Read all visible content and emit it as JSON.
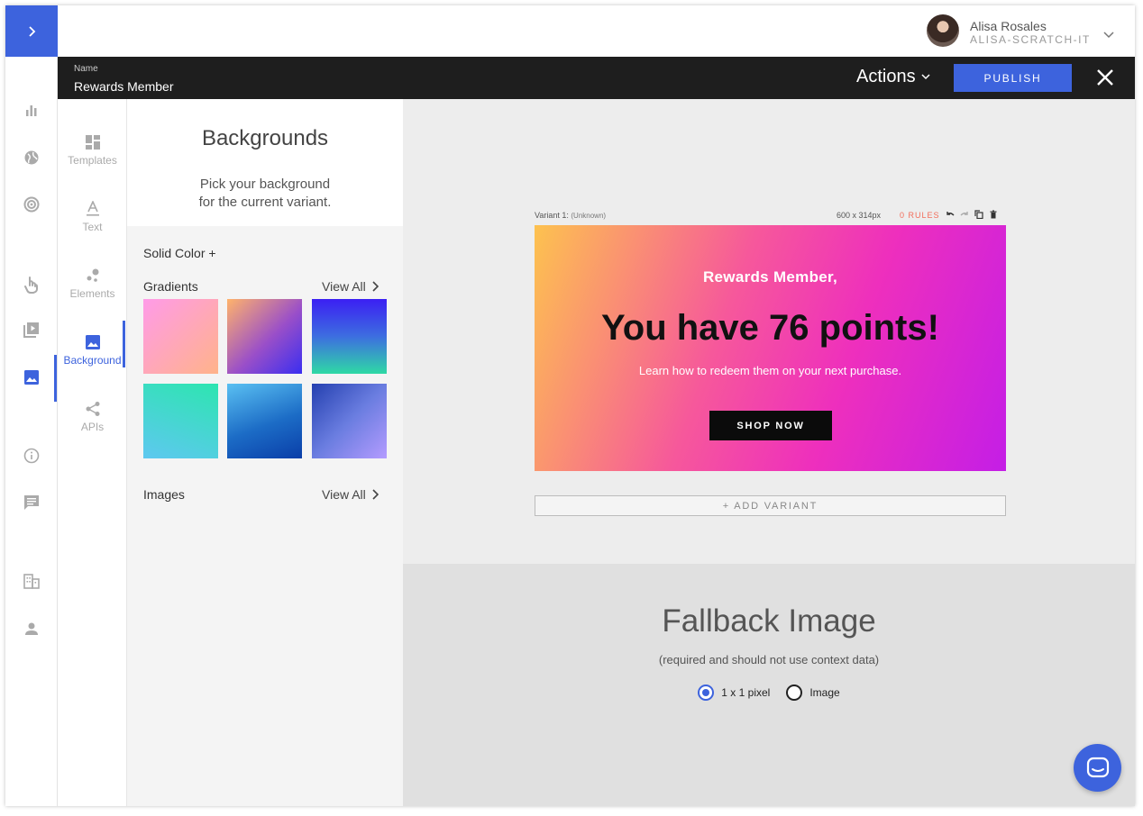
{
  "user": {
    "name": "Alisa Rosales",
    "org": "ALISA-SCRATCH-IT"
  },
  "header": {
    "name_label": "Name",
    "name_value": "Rewards Member",
    "actions_label": "Actions",
    "publish_label": "PUBLISH"
  },
  "tools": [
    {
      "label": "Templates",
      "icon": "templates-icon"
    },
    {
      "label": "Text",
      "icon": "text-icon"
    },
    {
      "label": "Elements",
      "icon": "elements-icon"
    },
    {
      "label": "Background",
      "icon": "image-icon",
      "active": true
    },
    {
      "label": "APIs",
      "icon": "share-icon"
    }
  ],
  "panel": {
    "title": "Backgrounds",
    "subtitle_line1": "Pick your background",
    "subtitle_line2": "for the current variant.",
    "solid_color": "Solid Color +",
    "gradients": "Gradients",
    "images": "Images",
    "view_all": "View All"
  },
  "variant": {
    "label": "Variant 1:",
    "context": "(Unknown)",
    "size": "600 x 314px",
    "rules": "0 RULES"
  },
  "banner": {
    "greeting": "Rewards Member,",
    "headline": "You have 76 points!",
    "subline": "Learn how to redeem them on your next purchase.",
    "button": "SHOP NOW"
  },
  "add_variant": "+ ADD VARIANT",
  "fallback": {
    "title": "Fallback Image",
    "subtitle": "(required and should not use context data)",
    "option_pixel": "1 x 1 pixel",
    "option_image": "Image",
    "selected": "1 x 1 pixel"
  },
  "colors": {
    "accent": "#3d63dd",
    "dark_bar": "#1e1e1e",
    "rules": "#f26d5b"
  }
}
